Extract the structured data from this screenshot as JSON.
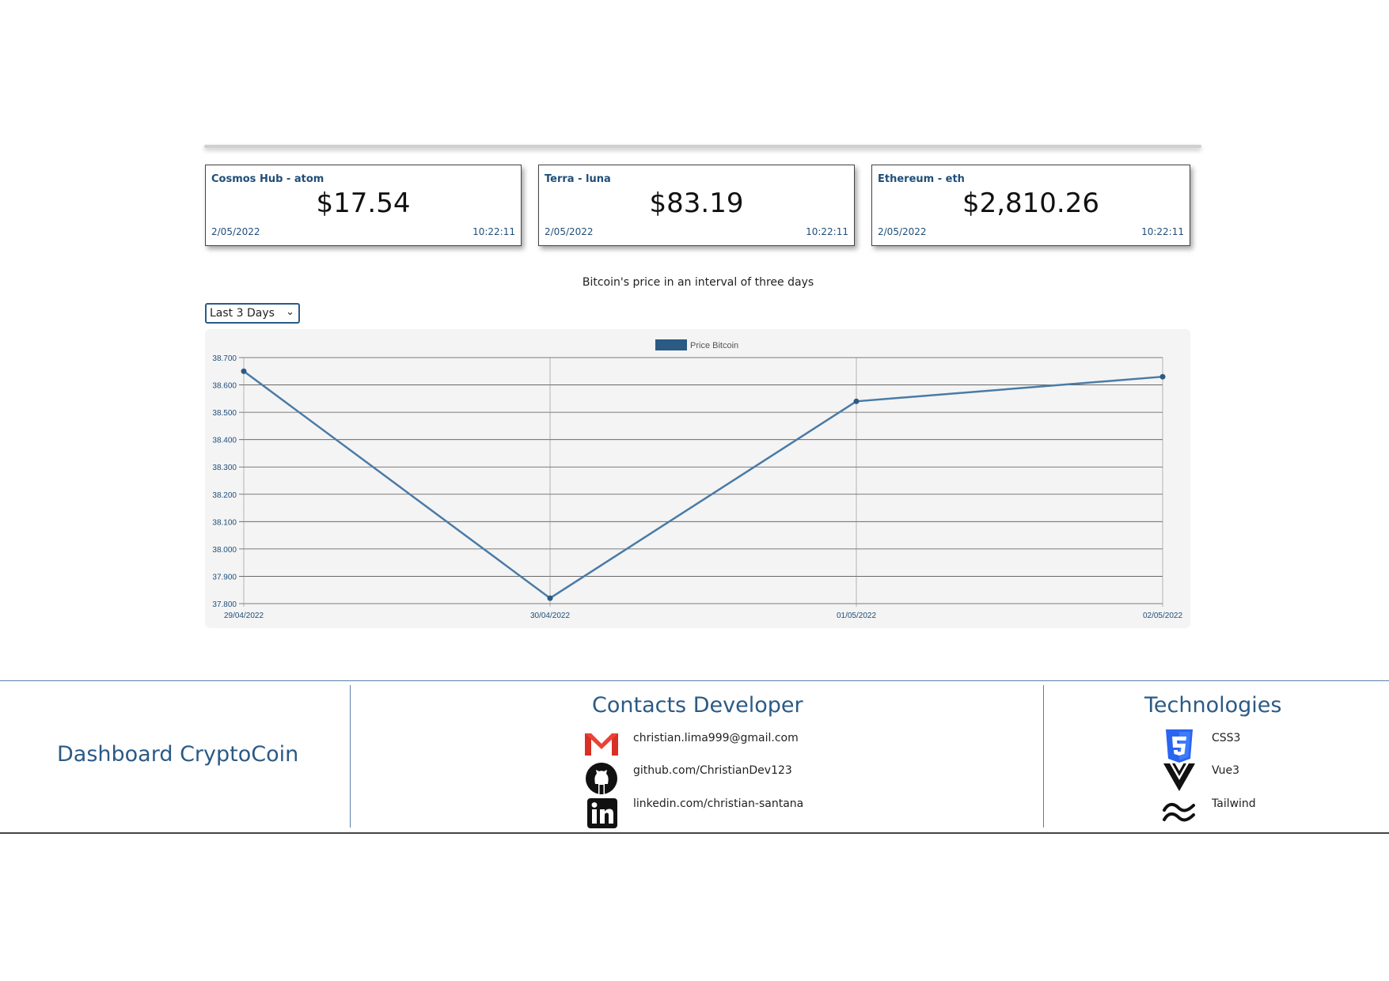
{
  "cards": [
    {
      "name": "Cosmos Hub - atom",
      "price": "$17.54",
      "date": "2/05/2022",
      "time": "10:22:11"
    },
    {
      "name": "Terra - luna",
      "price": "$83.19",
      "date": "2/05/2022",
      "time": "10:22:11"
    },
    {
      "name": "Ethereum - eth",
      "price": "$2,810.26",
      "date": "2/05/2022",
      "time": "10:22:11"
    }
  ],
  "chart_title": "Bitcoin's price in an interval of three days",
  "range_select": {
    "selected": "Last 3 Days"
  },
  "chart_data": {
    "type": "line",
    "title": "Bitcoin's price in an interval of three days",
    "categories": [
      "29/04/2022",
      "30/04/2022",
      "01/05/2022",
      "02/05/2022"
    ],
    "series": [
      {
        "name": "Price Bitcoin",
        "values": [
          38650,
          37820,
          38540,
          38630
        ]
      }
    ],
    "yticks": [
      "38.700",
      "38.600",
      "38.500",
      "38.400",
      "38.300",
      "38.200",
      "38.100",
      "38.000",
      "37.900",
      "37.800"
    ],
    "ylim": [
      37800,
      38700
    ],
    "grid": true,
    "legend": "top-center",
    "color": "#4a7ba6"
  },
  "footer": {
    "brand": "Dashboard CryptoCoin",
    "contacts_title": "Contacts Developer",
    "contacts": [
      {
        "icon": "gmail-icon",
        "text": "christian.lima999@gmail.com"
      },
      {
        "icon": "github-icon",
        "text": "github.com/ChristianDev123"
      },
      {
        "icon": "linkedin-icon",
        "text": "linkedin.com/christian-santana"
      }
    ],
    "tech_title": "Technologies",
    "technologies": [
      {
        "icon": "css3-icon",
        "text": "CSS3"
      },
      {
        "icon": "vue-icon",
        "text": "Vue3"
      },
      {
        "icon": "tailwind-icon",
        "text": "Tailwind"
      }
    ]
  }
}
